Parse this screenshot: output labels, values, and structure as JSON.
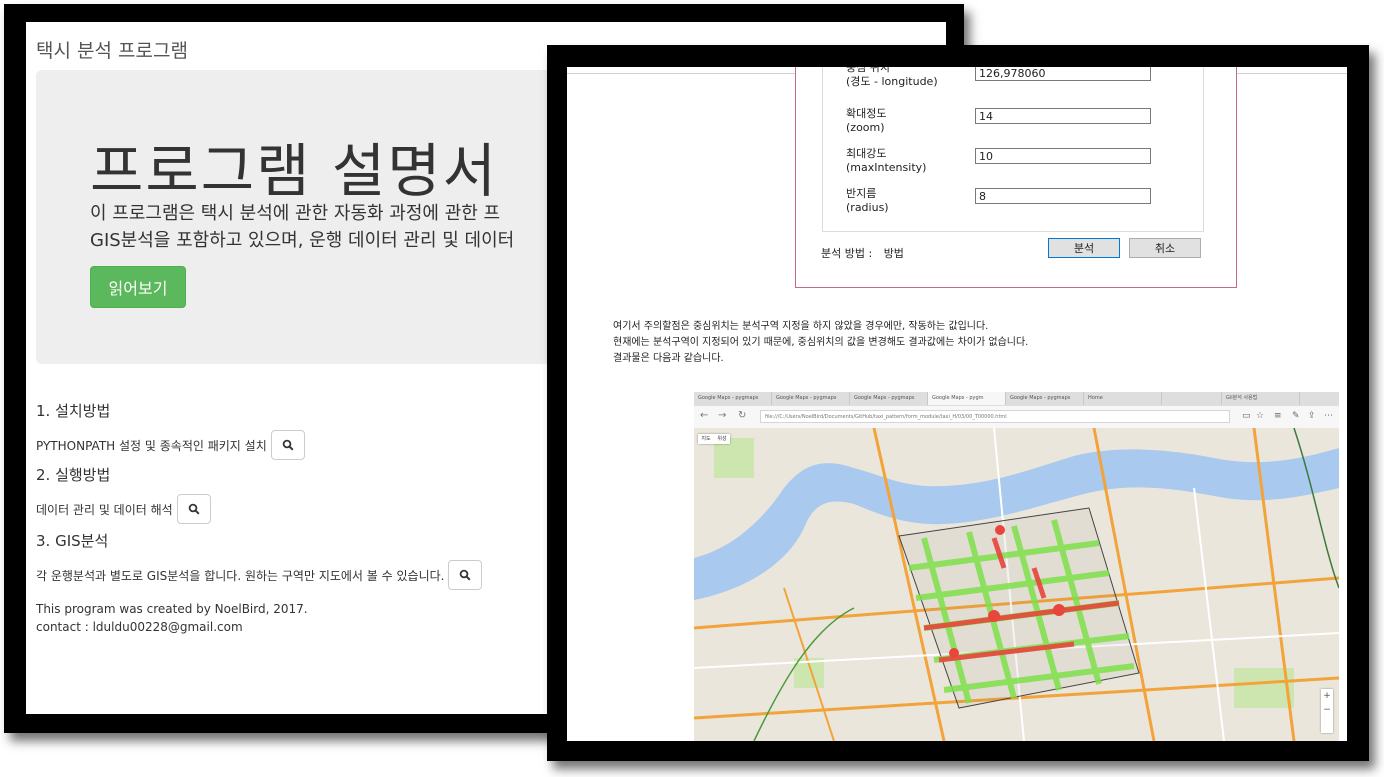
{
  "left_window": {
    "brand": "택시 분석 프로그램",
    "jumbotron": {
      "title": "프로그램 설명서",
      "lead_line1": "이 프로그램은 택시 분석에 관한 자동화 과정에 관한 프",
      "lead_line2": "GIS분석을 포함하고 있으며, 운행 데이터 관리 및 데이터",
      "read_button": "읽어보기"
    },
    "sections": [
      {
        "heading": "1. 설치방법",
        "text": "PYTHONPATH 설정 및 종속적인 패키지 설치",
        "button_icon": "search-icon"
      },
      {
        "heading": "2. 실행방법",
        "text": "데이터 관리 및 데이터 해석",
        "button_icon": "search-icon"
      },
      {
        "heading": "3. GIS분석",
        "text": "각 운행분석과 별도로 GIS분석을 합니다. 원하는 구역만 지도에서 볼 수 있습니다.",
        "button_icon": "search-icon"
      }
    ],
    "footer": {
      "line1": "This program was created by NoelBird, 2017.",
      "line2": "contact : lduldu00228@gmail.com"
    }
  },
  "right_window": {
    "dialog": {
      "fields": [
        {
          "label_ko": "중심 위치",
          "label_en": "(경도 - longitude)",
          "value": "126,978060"
        },
        {
          "label_ko": "확대정도",
          "label_en": "(zoom)",
          "value": "14"
        },
        {
          "label_ko": "최대강도",
          "label_en": "(maxIntensity)",
          "value": "10"
        },
        {
          "label_ko": "반지름",
          "label_en": "(radius)",
          "value": "8"
        }
      ],
      "method_label": "분석 방법 :",
      "method_value": "방법",
      "analyze_button": "분석",
      "cancel_button": "취소"
    },
    "paragraph": [
      "여기서 주의할점은 중심위치는 분석구역 지정을 하지 않았을 경우에만, 작동하는 값입니다.",
      "현재에는 분석구역이 지정되어 있기 때문에, 중심위치의 값을 변경해도 결과값에는 차이가 없습니다.",
      "결과물은 다음과 같습니다."
    ],
    "browser": {
      "tabs": [
        "Google Maps - pygmaps",
        "Google Maps - pygmaps",
        "Google Maps - pygmaps",
        "Google Maps - pygm",
        "Google Maps - pygmaps",
        "Home",
        "",
        "Gil분석 사용법"
      ],
      "url": "file:///C:/Users/NoelBird/Documents/GitHub/taxi_pattern/form_module/taxi_H/03/00_T00000.html",
      "map_buttons": [
        "지도",
        "위성"
      ],
      "zoom_plus": "+",
      "zoom_minus": "−"
    }
  }
}
